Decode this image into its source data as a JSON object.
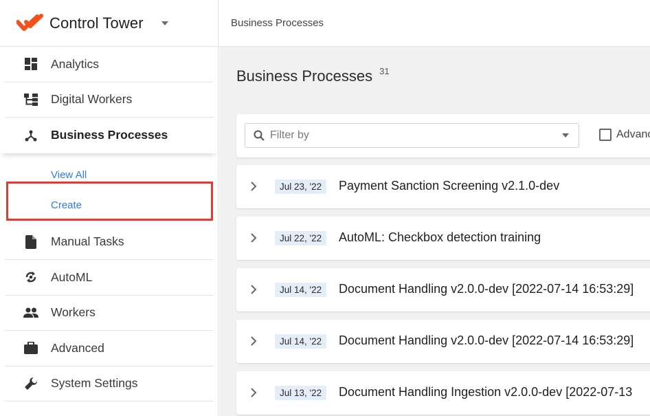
{
  "app": {
    "title": "Control Tower",
    "brand_color": "#f4511e"
  },
  "sidebar": {
    "items": [
      {
        "label": "Analytics",
        "icon": "dashboard-icon"
      },
      {
        "label": "Digital Workers",
        "icon": "hierarchy-icon"
      },
      {
        "label": "Business Processes",
        "icon": "process-tree-icon",
        "active": true
      },
      {
        "label": "Manual Tasks",
        "icon": "document-icon"
      },
      {
        "label": "AutoML",
        "icon": "automl-icon"
      },
      {
        "label": "Workers",
        "icon": "people-icon"
      },
      {
        "label": "Advanced",
        "icon": "briefcase-icon"
      },
      {
        "label": "System Settings",
        "icon": "wrench-icon"
      }
    ],
    "sub_items": [
      {
        "label": "View All"
      },
      {
        "label": "Create",
        "highlighted": true
      }
    ]
  },
  "topbar": {
    "breadcrumb": "Business Processes"
  },
  "page": {
    "title": "Business Processes",
    "count": "31"
  },
  "filter": {
    "placeholder": "Filter by",
    "advanced_label": "Advanc"
  },
  "processes": [
    {
      "date": "Jul 23, '22",
      "name": "Payment Sanction Screening v2.1.0-dev"
    },
    {
      "date": "Jul 22, '22",
      "name": "AutoML: Checkbox detection training"
    },
    {
      "date": "Jul 14, '22",
      "name": "Document Handling v2.0.0-dev [2022-07-14 16:53:29]"
    },
    {
      "date": "Jul 14, '22",
      "name": "Document Handling v2.0.0-dev [2022-07-14 16:53:29]"
    },
    {
      "date": "Jul 13, '22",
      "name": "Document Handling Ingestion v2.0.0-dev [2022-07-13"
    }
  ],
  "colors": {
    "link": "#2f7be6",
    "highlight_border": "#e53935",
    "date_badge_bg": "#e4eef9"
  }
}
